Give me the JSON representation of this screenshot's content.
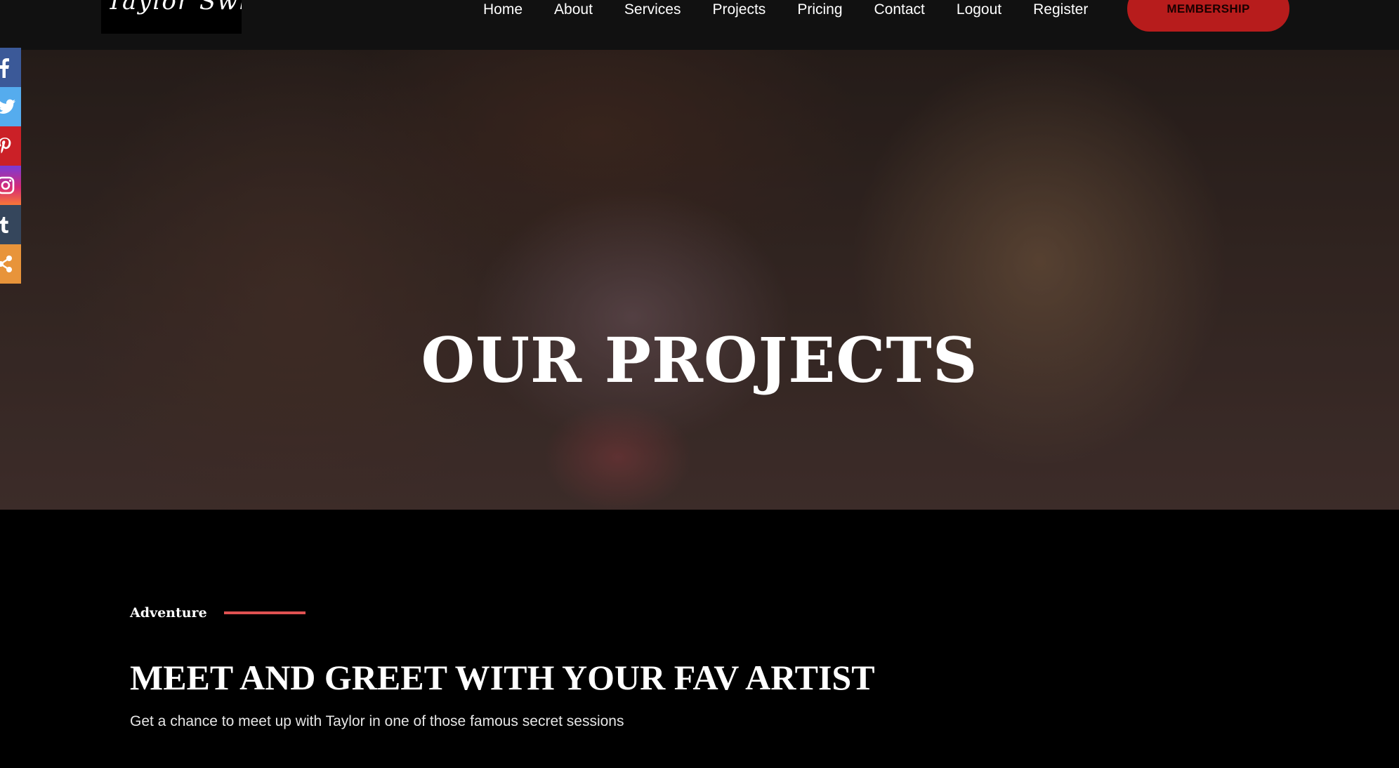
{
  "header": {
    "logo_text": "Taylor Swift",
    "nav": [
      "Home",
      "About",
      "Services",
      "Projects",
      "Pricing",
      "Contact",
      "Logout",
      "Register"
    ],
    "membership_label": "MEMBERSHIP"
  },
  "social": {
    "items": [
      {
        "name": "facebook",
        "icon": "facebook-icon",
        "color": "#3b5998"
      },
      {
        "name": "twitter",
        "icon": "twitter-icon",
        "color": "#55acee"
      },
      {
        "name": "pinterest",
        "icon": "pinterest-icon",
        "color": "#cb2027"
      },
      {
        "name": "instagram",
        "icon": "instagram-icon",
        "color": "#d62976"
      },
      {
        "name": "tumblr",
        "icon": "tumblr-icon",
        "color": "#35465c"
      },
      {
        "name": "share",
        "icon": "share-icon",
        "color": "#e8943a"
      }
    ]
  },
  "hero": {
    "title": "OUR PROJECTS"
  },
  "project": {
    "category": "Adventure",
    "title": "MEET AND GREET WITH YOUR FAV ARTIST",
    "description": "Get a chance to meet up with Taylor in one of those famous secret sessions"
  },
  "colors": {
    "accent": "#b71c1c",
    "eyebrow_line": "#e05252",
    "header_bg": "#111111",
    "page_bg": "#000000"
  }
}
